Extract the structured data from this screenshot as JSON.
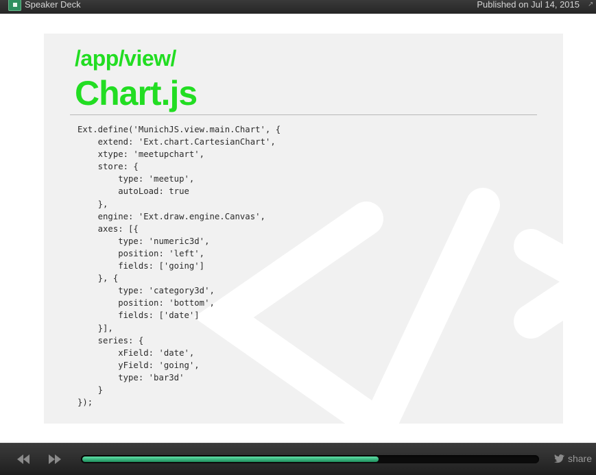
{
  "header": {
    "brand": "Speaker Deck",
    "published": "Published on Jul 14, 2015"
  },
  "slide": {
    "path": "/app/view/",
    "filename": "Chart.js",
    "code": "Ext.define('MunichJS.view.main.Chart', {\n    extend: 'Ext.chart.CartesianChart',\n    xtype: 'meetupchart',\n    store: {\n        type: 'meetup',\n        autoLoad: true\n    },\n    engine: 'Ext.draw.engine.Canvas',\n    axes: [{\n        type: 'numeric3d',\n        position: 'left',\n        fields: ['going']\n    }, {\n        type: 'category3d',\n        position: 'bottom',\n        fields: ['date']\n    }],\n    series: {\n        xField: 'date',\n        yField: 'going',\n        type: 'bar3d'\n    }\n});"
  },
  "controls": {
    "progress": 0.65,
    "share_label": "share",
    "accent": "#2fbf7f"
  },
  "icons": {
    "logo": "speakerdeck-logo-icon",
    "expand": "expand-icon",
    "prev": "rewind-icon",
    "next": "fast-forward-icon",
    "share": "twitter-bird-icon"
  }
}
